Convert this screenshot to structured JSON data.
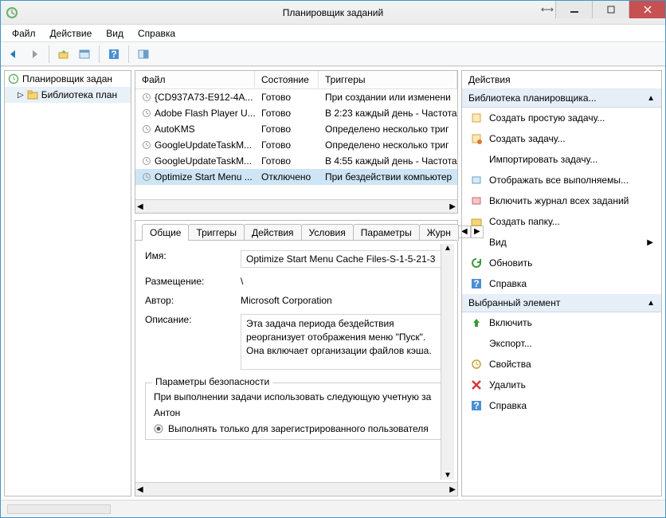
{
  "window": {
    "title": "Планировщик заданий"
  },
  "menu": [
    "Файл",
    "Действие",
    "Вид",
    "Справка"
  ],
  "tree": {
    "root": "Планировщик задан",
    "child": "Библиотека план"
  },
  "tasks": {
    "headers": {
      "file": "Файл",
      "state": "Состояние",
      "triggers": "Триггеры"
    },
    "rows": [
      {
        "file": "{CD937A73-E912-4A...",
        "state": "Готово",
        "trig": "При создании или изменени"
      },
      {
        "file": "Adobe Flash Player U...",
        "state": "Готово",
        "trig": "В 2:23 каждый день - Частота"
      },
      {
        "file": "AutoKMS",
        "state": "Готово",
        "trig": "Определено несколько триг"
      },
      {
        "file": "GoogleUpdateTaskM...",
        "state": "Готово",
        "trig": "Определено несколько триг"
      },
      {
        "file": "GoogleUpdateTaskM...",
        "state": "Готово",
        "trig": "В 4:55 каждый день - Частота"
      },
      {
        "file": "Optimize Start Menu ...",
        "state": "Отключено",
        "trig": "При бездействии компьютер"
      }
    ]
  },
  "tabs": [
    "Общие",
    "Триггеры",
    "Действия",
    "Условия",
    "Параметры",
    "Журн"
  ],
  "details": {
    "name_label": "Имя:",
    "name_value": "Optimize Start Menu Cache Files-S-1-5-21-3",
    "location_label": "Размещение:",
    "location_value": "\\",
    "author_label": "Автор:",
    "author_value": "Microsoft Corporation",
    "desc_label": "Описание:",
    "desc_value": "Эта задача периода бездействия реорганизует отображения меню \"Пуск\". Она включает организации файлов кэша.",
    "security_title": "Параметры безопасности",
    "security_label": "При выполнении задачи использовать следующую учетную за",
    "security_user": "Антон",
    "security_radio": "Выполнять только для зарегистрированного пользователя"
  },
  "actions": {
    "title": "Действия",
    "section1": "Библиотека планировщика...",
    "section1_items": [
      "Создать простую задачу...",
      "Создать задачу...",
      "Импортировать задачу...",
      "Отображать все выполняемы...",
      "Включить журнал всех заданий",
      "Создать папку...",
      "Вид",
      "Обновить",
      "Справка"
    ],
    "section2": "Выбранный элемент",
    "section2_items": [
      "Включить",
      "Экспорт...",
      "Свойства",
      "Удалить",
      "Справка"
    ]
  }
}
